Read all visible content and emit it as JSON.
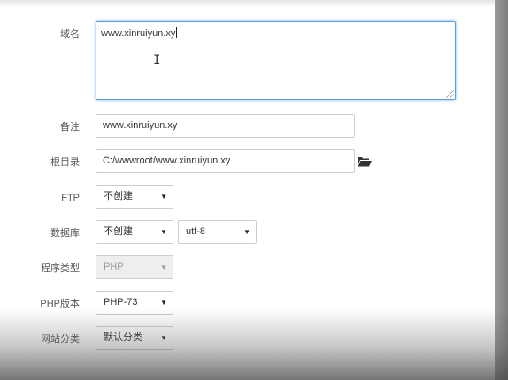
{
  "form": {
    "domain": {
      "label": "域名",
      "value": "www.xinruiyun.xy"
    },
    "remark": {
      "label": "备注",
      "value": "www.xinruiyun.xy"
    },
    "root_dir": {
      "label": "根目录",
      "value": "C:/wwwroot/www.xinruiyun.xy"
    },
    "ftp": {
      "label": "FTP",
      "value": "不创建"
    },
    "database": {
      "label": "数据库",
      "value": "不创建",
      "charset": "utf-8"
    },
    "program_type": {
      "label": "程序类型",
      "value": "PHP"
    },
    "php_version": {
      "label": "PHP版本",
      "value": "PHP-73"
    },
    "site_category": {
      "label": "网站分类",
      "value": "默认分类"
    }
  },
  "icons": {
    "folder": "folder-open-icon",
    "dropdown": "caret-down-icon"
  },
  "colors": {
    "focus_border": "#5aa0e0",
    "input_border": "#cccccc"
  }
}
